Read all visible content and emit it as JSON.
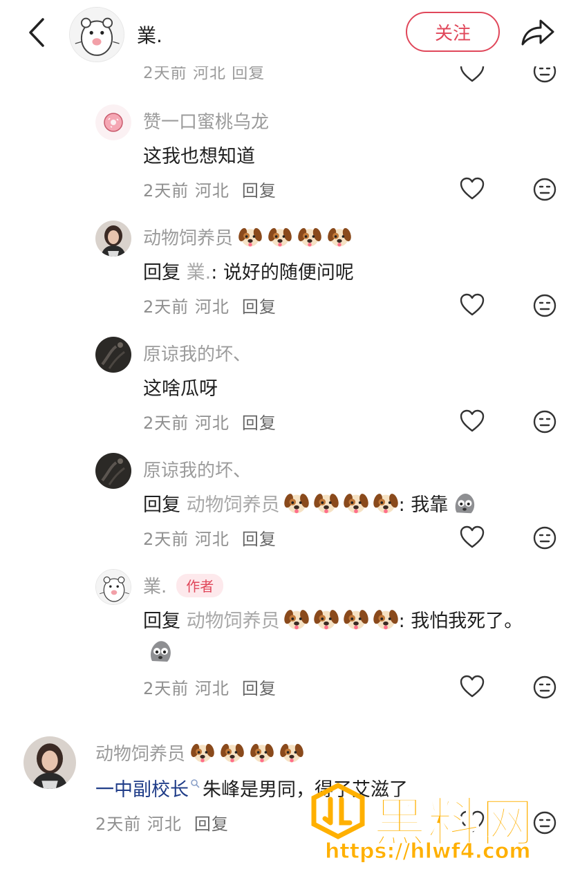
{
  "header": {
    "user_name": "業.",
    "follow_label": "关注"
  },
  "peek": {
    "text": "2天前 河北 回复"
  },
  "comments": [
    {
      "name": "赞一口蜜桃乌龙",
      "body": "这我也想知道",
      "time": "2天前",
      "location": "河北",
      "reply_label": "回复"
    },
    {
      "name": "动物饲养员",
      "body_prefix": "回复",
      "body_target": "業.",
      "body_text": ": 说好的随便问呢",
      "time": "2天前",
      "location": "河北",
      "reply_label": "回复"
    },
    {
      "name": "原谅我的坏、",
      "body": "这啥瓜呀",
      "time": "2天前",
      "location": "河北",
      "reply_label": "回复"
    },
    {
      "name": "原谅我的坏、",
      "body_prefix": "回复",
      "body_target": "动物饲养员",
      "body_text": ": 我靠",
      "time": "2天前",
      "location": "河北",
      "reply_label": "回复"
    },
    {
      "name": "業.",
      "author_tag": "作者",
      "body_prefix": "回复",
      "body_target": "动物饲养员",
      "body_text": ": 我怕我死了。",
      "time": "2天前",
      "location": "河北",
      "reply_label": "回复"
    },
    {
      "name": "动物饲养员",
      "body_link": "一中副校长",
      "body_text": " 朱峰是男同，得了艾滋了",
      "time": "2天前",
      "location": "河北",
      "reply_label": "回复"
    }
  ],
  "watermark": {
    "title": "黑料网",
    "url": "https://hlwf4.com"
  },
  "colors": {
    "accent": "#e0475a",
    "meta_grey": "#8f8f8f",
    "link_blue": "#1f3c88",
    "watermark": "#ffb000"
  }
}
